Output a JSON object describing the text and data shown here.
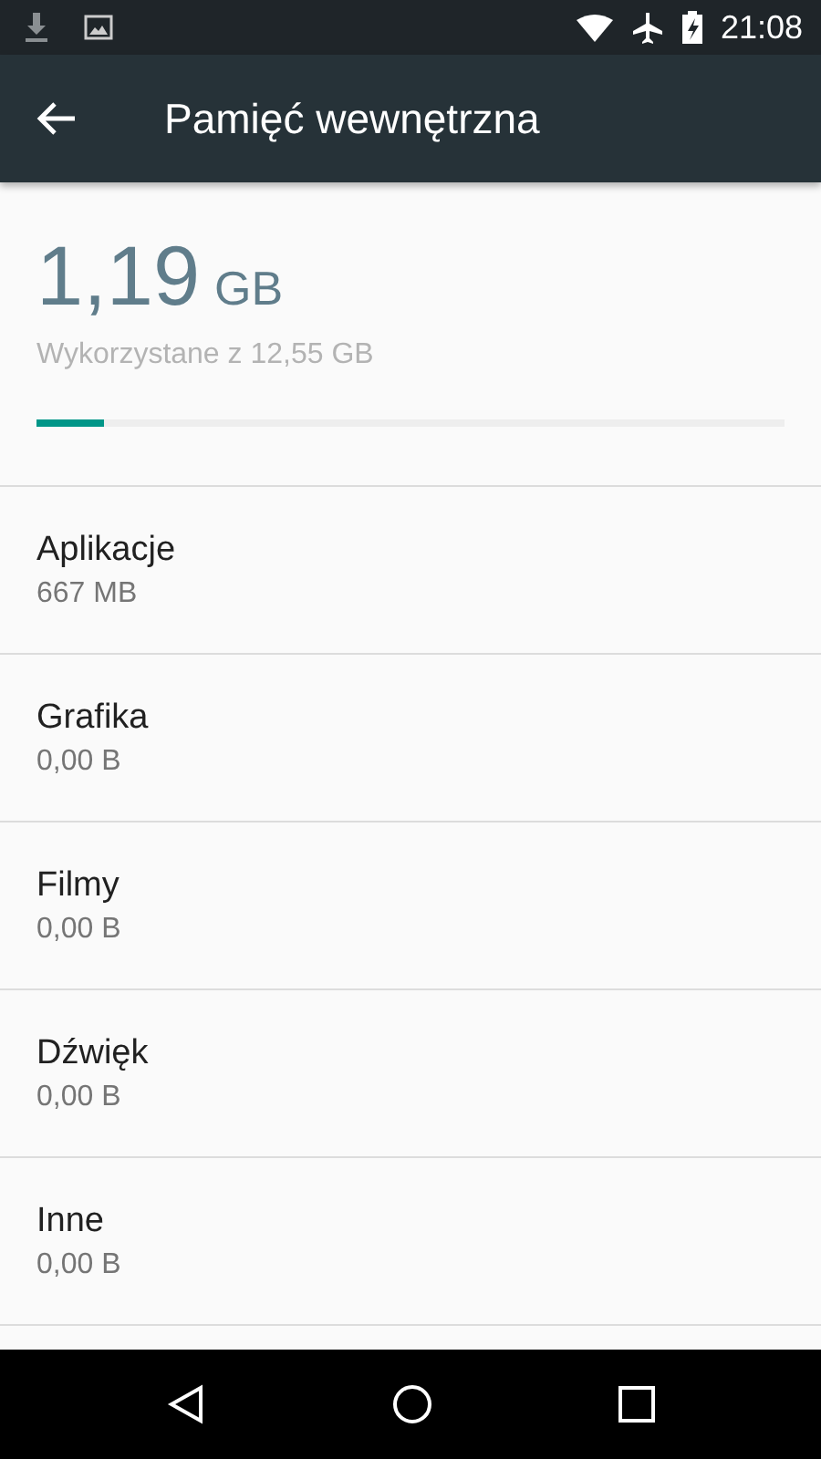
{
  "status_bar": {
    "time": "21:08"
  },
  "app_bar": {
    "title": "Pamięć wewnętrzna"
  },
  "summary": {
    "used": "1,19",
    "unit": "GB",
    "caption": "Wykorzystane z 12,55 GB",
    "level": 0.09
  },
  "items": [
    {
      "label": "Aplikacje",
      "size": "667 MB"
    },
    {
      "label": "Grafika",
      "size": "0,00 B"
    },
    {
      "label": "Filmy",
      "size": "0,00 B"
    },
    {
      "label": "Dźwięk",
      "size": "0,00 B"
    },
    {
      "label": "Inne",
      "size": "0,00 B"
    }
  ]
}
